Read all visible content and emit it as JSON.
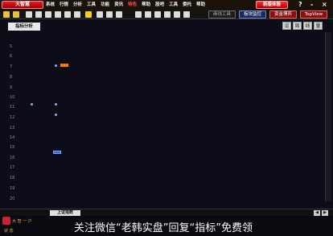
{
  "menubar": {
    "logo_label": "大智慧",
    "items": [
      "系统",
      "行情",
      "分析",
      "工具",
      "功能",
      "资讯",
      "特色",
      "帮助",
      "股吧",
      "工具",
      "委托",
      "帮助"
    ],
    "highlight_index": 6,
    "promo_label": "新版体验",
    "window_controls": [
      "?",
      "-",
      "×"
    ]
  },
  "toolbar": {
    "buttons": [
      "画线工具",
      "板块监控",
      "资金博弈",
      "TopView"
    ],
    "icons": [
      "folder-icon",
      "star-icon",
      "grid-icon",
      "chart-icon",
      "edit-icon",
      "search-icon",
      "table-icon",
      "list-icon"
    ]
  },
  "main": {
    "title_tab": "指标分析",
    "right_controls": [
      "设",
      "周",
      "线",
      "量"
    ],
    "row_labels": [
      "5",
      "6",
      "7",
      "8",
      "9",
      "10",
      "11",
      "12",
      "13",
      "14",
      "15",
      "16",
      "17",
      "18",
      "19",
      "20"
    ]
  },
  "bottom": {
    "tab_label": "上证指数",
    "controls": [
      "◀",
      "▶"
    ]
  },
  "status": {
    "left_text_1": "大 智 一 户",
    "left_text_2": "状 态"
  },
  "watermark": {
    "text": "关注微信“老韩实盘”回复“指标”免费领"
  },
  "colors": {
    "accent_red": "#e02020",
    "accent_orange": "#ff7a00",
    "accent_blue": "#3060ff"
  }
}
